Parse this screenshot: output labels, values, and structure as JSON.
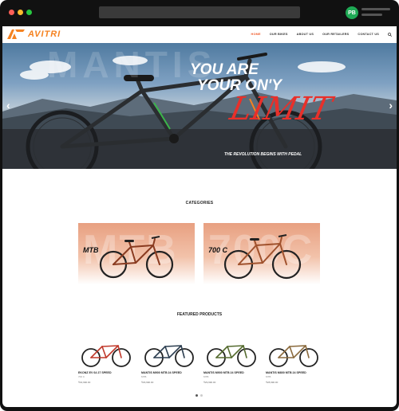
{
  "browser": {
    "avatar_initials": "PB",
    "traffic_lights": [
      "#ff5f57",
      "#febc2e",
      "#28c840"
    ]
  },
  "header": {
    "brand": "AVITRI",
    "menu": [
      {
        "label": "HOME",
        "active": true
      },
      {
        "label": "OUR BIKES",
        "active": false
      },
      {
        "label": "ABOUT US",
        "active": false
      },
      {
        "label": "OUR RETAILERS",
        "active": false
      },
      {
        "label": "CONTACT US",
        "active": false
      }
    ],
    "search_icon": "search-icon"
  },
  "hero": {
    "line1": "YOU ARE",
    "line2": "YOUR ON'Y",
    "script": "LIMIT",
    "tagline": "THE REVOLUTION BEGINS WITH PEDAL",
    "watermark": "MANTIS"
  },
  "categories": {
    "title": "CATEGORIES",
    "items": [
      {
        "label": "MTB",
        "bg_text": "MTB"
      },
      {
        "label": "700 C",
        "bg_text": "700C"
      }
    ]
  },
  "featured": {
    "title": "FEATURED PRODUCTS",
    "products": [
      {
        "name": "EKONZ EV 64 27 SPEED",
        "category": "700 C",
        "price": "₹32,990.00"
      },
      {
        "name": "MANTIS M900 MTB 24 SPEED",
        "category": "MTB",
        "price": "₹29,990.00"
      },
      {
        "name": "MANTIS M900 MTB 24 SPEED",
        "category": "MTB",
        "price": "₹29,990.00"
      },
      {
        "name": "MANTIS M800 MTB 24 SPEED",
        "category": "MTB",
        "price": "₹28,990.00"
      }
    ]
  },
  "colors": {
    "accent": "#f05a28",
    "brand_orange": "#f58220",
    "script_red": "#e8302a"
  }
}
